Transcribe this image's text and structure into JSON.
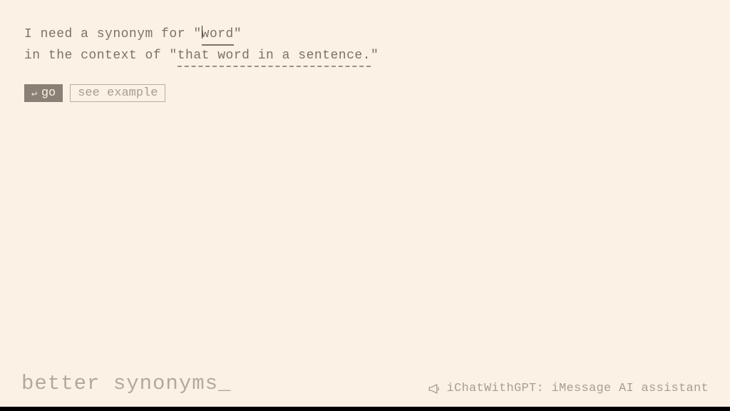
{
  "prompt": {
    "line1_prefix": "I need a synonym for \"",
    "line1_input": "word",
    "line1_suffix": "\"",
    "line2_prefix": "in the context of \"",
    "line2_input": "that word in a sentence.",
    "line2_suffix": "\""
  },
  "buttons": {
    "go_label": "go",
    "enter_symbol": "↵",
    "example_label": "see example"
  },
  "footer": {
    "title_text": "better synonyms",
    "cursor": "_",
    "promo_text": "iChatWithGPT: iMessage AI assistant"
  }
}
